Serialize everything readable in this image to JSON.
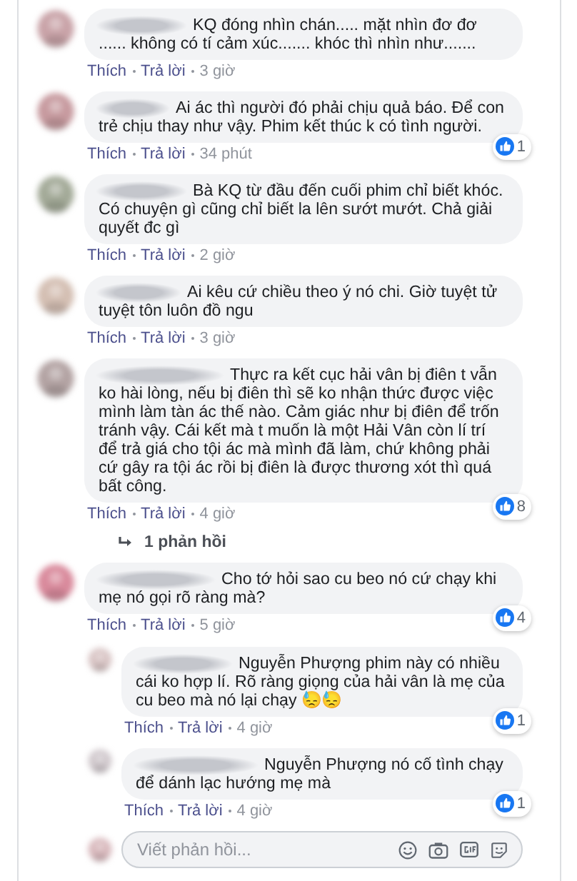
{
  "comments": [
    {
      "text": "KQ đóng nhìn chán..... mặt nhìn đơ đơ ...... không có tí cảm xúc....... khóc thì nhìn như.......",
      "like": "Thích",
      "reply": "Trả lời",
      "time": "3 giờ"
    },
    {
      "text": "Ai ác thì người đó phải chịu quả báo. Để con trẻ chịu thay như vậy. Phim kết thúc k có tình người.",
      "like": "Thích",
      "reply": "Trả lời",
      "time": "34 phút",
      "reactions": "1"
    },
    {
      "text": "Bà KQ từ đầu đến cuối phim chỉ biết khóc. Có chuyện gì cũng chỉ biết la lên sướt mướt. Chả giải quyết đc gì",
      "like": "Thích",
      "reply": "Trả lời",
      "time": "2 giờ"
    },
    {
      "text": "Ai kêu cứ chiều theo ý nó chi. Giờ tuyệt tử tuyệt tôn luôn đồ ngu",
      "like": "Thích",
      "reply": "Trả lời",
      "time": "3 giờ"
    },
    {
      "text": "Thực ra kết cục hải vân bị điên t vẫn ko hài lòng, nếu bị điên thì sẽ ko nhận thức được việc mình làm tàn ác thế nào. Cảm giác như bị điên để trốn tránh vậy. Cái kết mà t muốn là một Hải Vân còn lí trí để trả giá cho tội ác mà mình đã làm, chứ không phải cứ gây ra tội ác rồi bị điên là được thương xót thì quá bất công.",
      "like": "Thích",
      "reply": "Trả lời",
      "time": "4 giờ",
      "reactions": "8",
      "replies_link": "1 phản hồi"
    },
    {
      "text": "Cho tớ hỏi sao cu beo nó cứ chạy khi mẹ nó gọi rõ ràng mà?",
      "like": "Thích",
      "reply": "Trả lời",
      "time": "5 giờ",
      "reactions": "4",
      "children": [
        {
          "text": "Nguyễn Phượng phim này có nhiều cái ko hợp lí. Rõ ràng giọng của hải vân là mẹ của cu beo mà nó lại chạy 😓😓",
          "like": "Thích",
          "reply": "Trả lời",
          "time": "4 giờ",
          "reactions": "1"
        },
        {
          "text": "Nguyễn Phượng nó cố tình chạy để dánh lạc hướng mẹ mà",
          "like": "Thích",
          "reply": "Trả lời",
          "time": "4 giờ",
          "reactions": "1"
        }
      ],
      "reply_box": {
        "placeholder": "Viết phản hồi..."
      }
    }
  ]
}
